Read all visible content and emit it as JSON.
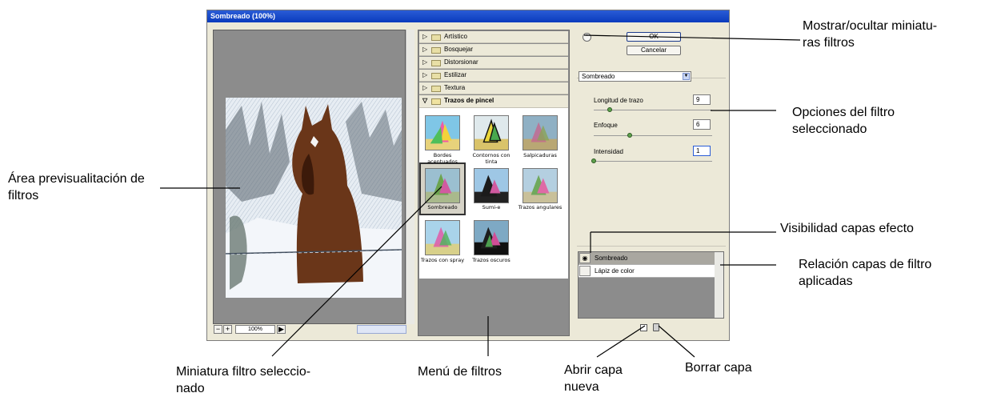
{
  "window": {
    "title": "Sombreado (100%)"
  },
  "preview": {
    "zoom_minus": "−",
    "zoom_plus": "+",
    "zoom_level": "100%",
    "menu_arrow": "▶"
  },
  "filter_menu": {
    "categories": [
      {
        "label": "Artístico",
        "expanded": false
      },
      {
        "label": "Bosquejar",
        "expanded": false
      },
      {
        "label": "Distorsionar",
        "expanded": false
      },
      {
        "label": "Estilizar",
        "expanded": false
      },
      {
        "label": "Textura",
        "expanded": false
      },
      {
        "label": "Trazos de pincel",
        "expanded": true
      }
    ],
    "thumbnails": [
      "Bordes acentuados",
      "Contornos con tinta",
      "Salpicaduras",
      "Sombreado",
      "Sumi-e",
      "Trazos angulares",
      "Trazos con spray",
      "Trazos oscuros"
    ],
    "selected": "Sombreado"
  },
  "options": {
    "ok_label": "OK",
    "cancel_label": "Cancelar",
    "selected_filter": "Sombreado",
    "params": [
      {
        "label": "Longitud de trazo",
        "value": "9"
      },
      {
        "label": "Enfoque",
        "value": "6"
      },
      {
        "label": "Intensidad",
        "value": "1"
      }
    ]
  },
  "layers": {
    "items": [
      {
        "label": "Sombreado",
        "visible": true,
        "selected": true
      },
      {
        "label": "Lápiz de color",
        "visible": false,
        "selected": false
      }
    ]
  },
  "annotations": {
    "toggle_thumbs": [
      "Mostrar/ocultar miniatu-",
      "ras filtros"
    ],
    "filter_options": [
      "Opciones del filtro",
      "seleccionado"
    ],
    "preview_area": [
      "Área previsualitación de",
      "filtros"
    ],
    "layer_visibility": [
      "Visibilidad capas efecto"
    ],
    "layer_list": [
      "Relación capas de filtro",
      "aplicadas"
    ],
    "selected_thumb": [
      "Miniatura filtro seleccio-",
      "nado"
    ],
    "filter_menu": [
      "Menú de filtros"
    ],
    "new_layer": [
      "Abrir capa",
      "nueva"
    ],
    "delete_layer": [
      "Borrar capa"
    ]
  }
}
